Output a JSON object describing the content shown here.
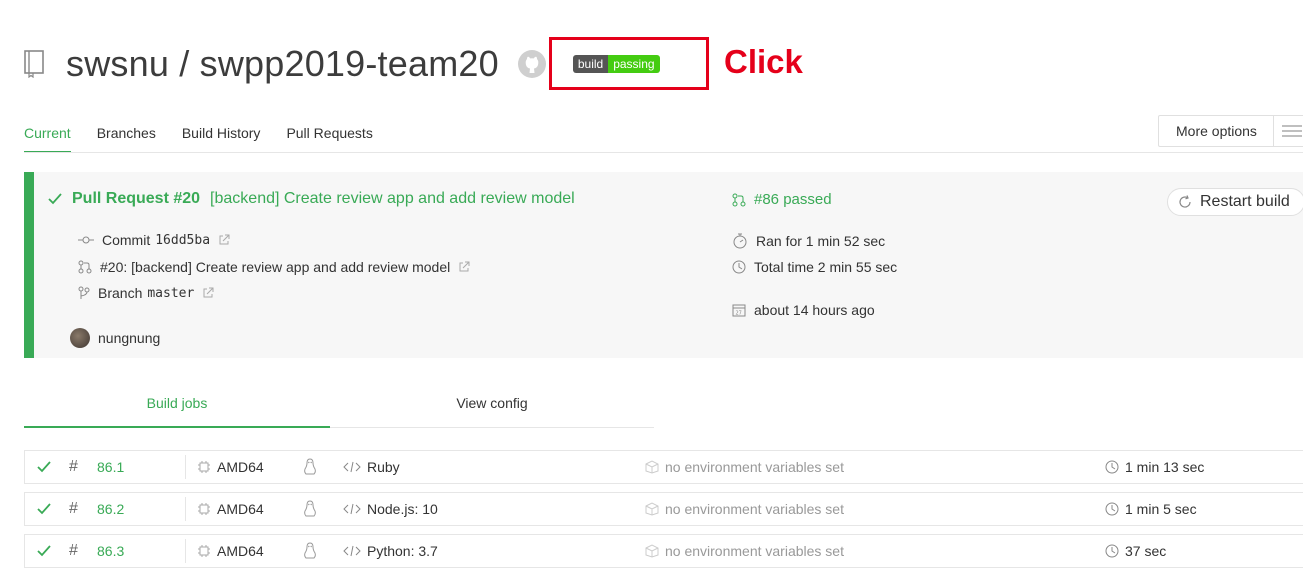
{
  "header": {
    "repo_title": "swsnu / swpp2019-team20",
    "badge_left": "build",
    "badge_right": "passing",
    "annotation": "Click"
  },
  "tabs": [
    {
      "label": "Current",
      "active": true
    },
    {
      "label": "Branches"
    },
    {
      "label": "Build History"
    },
    {
      "label": "Pull Requests"
    }
  ],
  "more_options": "More options",
  "build": {
    "pr_label": "Pull Request #20",
    "pr_title": "[backend] Create review app and add review model",
    "commit_label": "Commit",
    "commit_sha": "16dd5ba",
    "pr_link": "#20: [backend] Create review app and add review model",
    "branch_label": "Branch",
    "branch_name": "master",
    "author": "nungnung",
    "status": "#86 passed",
    "ran_for": "Ran for 1 min 52 sec",
    "total_time": "Total time 2 min 55 sec",
    "when": "about 14 hours ago",
    "restart": "Restart build"
  },
  "subtabs": {
    "build_jobs": "Build jobs",
    "view_config": "View config"
  },
  "jobs": [
    {
      "number": "86.1",
      "arch": "AMD64",
      "lang": "Ruby",
      "env": "no environment variables set",
      "duration": "1 min 13 sec"
    },
    {
      "number": "86.2",
      "arch": "AMD64",
      "lang": "Node.js: 10",
      "env": "no environment variables set",
      "duration": "1 min 5 sec"
    },
    {
      "number": "86.3",
      "arch": "AMD64",
      "lang": "Python: 3.7",
      "env": "no environment variables set",
      "duration": "37 sec"
    }
  ],
  "colors": {
    "accent_green": "#39aa56",
    "badge_green": "#44cc11",
    "annotation_red": "#e5001a"
  }
}
